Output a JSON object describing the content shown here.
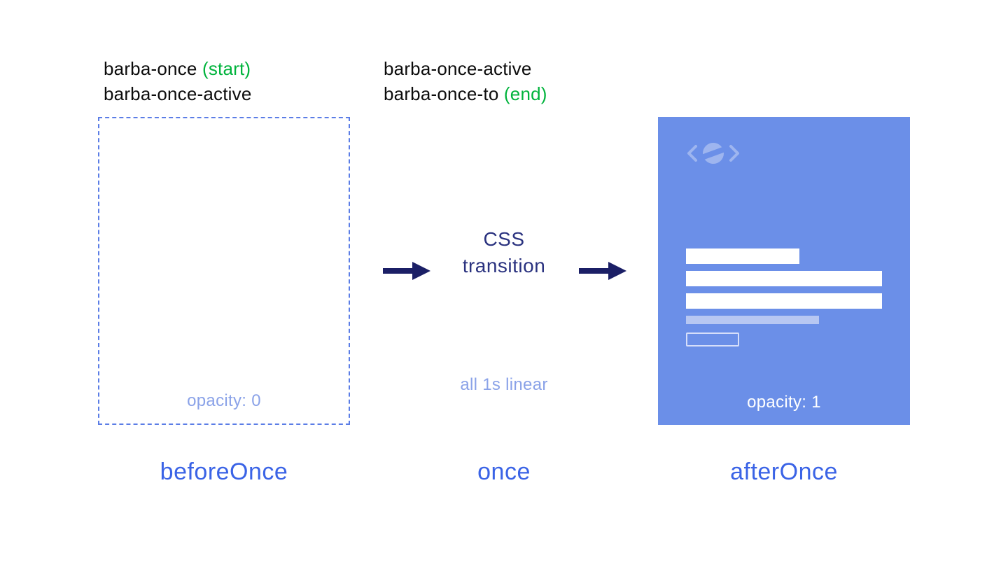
{
  "colors": {
    "accent_blue": "#3a63e6",
    "panel_blue": "#6b8fe8",
    "dashed_border": "#5b7de6",
    "dark_navy": "#2a327f",
    "muted_blue": "#8aa2e8",
    "green": "#00b33c"
  },
  "left": {
    "class_lines": [
      {
        "class": "barba-once",
        "annot": "(start)"
      },
      {
        "class": "barba-once-active",
        "annot": ""
      }
    ],
    "opacity_label": "opacity: 0",
    "stage_name": "beforeOnce"
  },
  "middle": {
    "class_lines": [
      {
        "class": "barba-once-active",
        "annot": ""
      },
      {
        "class": "barba-once-to",
        "annot": "(end)"
      }
    ],
    "title_line1": "CSS",
    "title_line2": "transition",
    "sub": "all 1s linear",
    "stage_name": "once"
  },
  "right": {
    "opacity_label": "opacity: 1",
    "stage_name": "afterOnce"
  }
}
